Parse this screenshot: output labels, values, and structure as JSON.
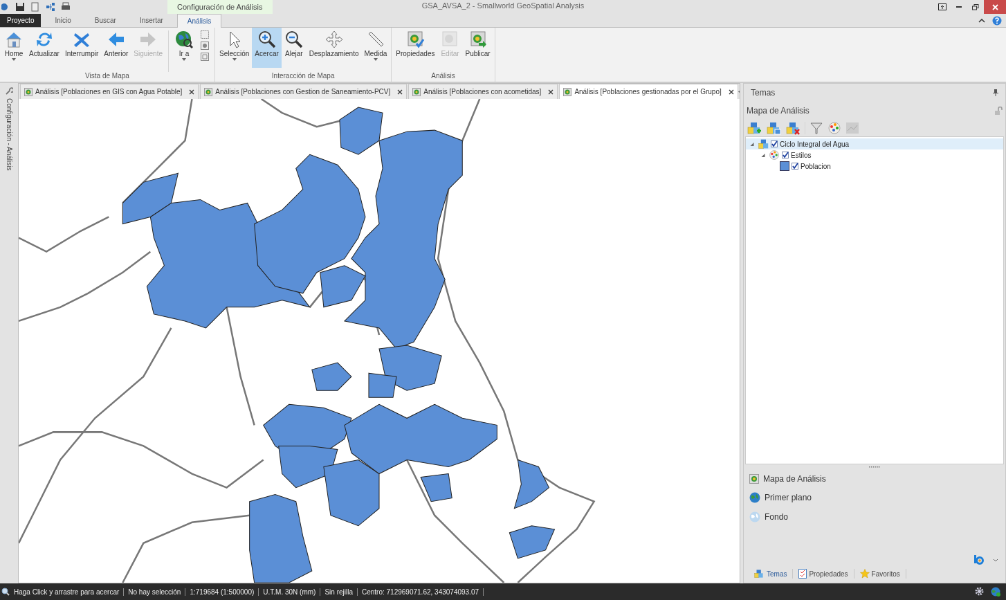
{
  "title_bar": {
    "context_tab": "Configuración de Análisis",
    "title": "GSA_AVSA_2 - Smallworld GeoSpatial Analysis"
  },
  "ribbon_tabs": [
    {
      "label": "Proyecto",
      "kind": "file",
      "selected": false
    },
    {
      "label": "Inicio",
      "kind": "tab",
      "selected": false
    },
    {
      "label": "Buscar",
      "kind": "tab",
      "selected": false
    },
    {
      "label": "Insertar",
      "kind": "tab",
      "selected": false
    },
    {
      "label": "Análisis",
      "kind": "tab",
      "selected": true
    }
  ],
  "ribbon_groups": [
    {
      "label": "Vista de Mapa",
      "buttons": [
        {
          "label": "Home",
          "dropdown": true,
          "disabled": false,
          "selected": false
        },
        {
          "label": "Actualizar",
          "dropdown": false,
          "disabled": false,
          "selected": false
        },
        {
          "label": "Interrumpir",
          "dropdown": false,
          "disabled": false,
          "selected": false
        },
        {
          "label": "Anterior",
          "dropdown": false,
          "disabled": false,
          "selected": false
        },
        {
          "label": "Siguiente",
          "dropdown": false,
          "disabled": true,
          "selected": false
        },
        {
          "label": "Ir a",
          "dropdown": true,
          "disabled": false,
          "selected": false
        }
      ]
    },
    {
      "label": "Interacción de Mapa",
      "buttons": [
        {
          "label": "Selección",
          "dropdown": true,
          "disabled": false,
          "selected": false
        },
        {
          "label": "Acercar",
          "dropdown": false,
          "disabled": false,
          "selected": true
        },
        {
          "label": "Alejar",
          "dropdown": false,
          "disabled": false,
          "selected": false
        },
        {
          "label": "Desplazamiento",
          "dropdown": false,
          "disabled": false,
          "selected": false
        },
        {
          "label": "Medida",
          "dropdown": true,
          "disabled": false,
          "selected": false
        }
      ]
    },
    {
      "label": "Análisis",
      "buttons": [
        {
          "label": "Propiedades",
          "dropdown": false,
          "disabled": false,
          "selected": false
        },
        {
          "label": "Editar",
          "dropdown": false,
          "disabled": true,
          "selected": false
        },
        {
          "label": "Publicar",
          "dropdown": false,
          "disabled": false,
          "selected": false
        }
      ]
    }
  ],
  "side_strip": {
    "label": "Configuración - Análisis"
  },
  "document_tabs": [
    {
      "label": "Análisis [Poblaciones en GIS con Agua Potable]",
      "selected": false
    },
    {
      "label": "Análisis [Poblaciones con Gestion de Saneamiento-PCV]",
      "selected": false
    },
    {
      "label": "Análisis [Poblaciones con acometidas]",
      "selected": false
    },
    {
      "label": "Análisis [Poblaciones gestionadas por el Grupo]",
      "selected": true
    }
  ],
  "panel": {
    "title": "Temas",
    "subtitle": "Mapa de Análisis",
    "tree": [
      {
        "label": "Ciclo Integral del Agua",
        "checked": true,
        "expanded": true,
        "selected": true,
        "children": [
          {
            "label": "Estilos",
            "checked": true,
            "expanded": true,
            "selected": false,
            "children": [
              {
                "label": "Poblacion",
                "checked": true,
                "selected": false,
                "color": "#5b8fd6"
              }
            ]
          }
        ]
      }
    ],
    "maps": [
      {
        "label": "Mapa de Análisis"
      },
      {
        "label": "Primer plano"
      },
      {
        "label": "Fondo"
      }
    ],
    "bottom_tabs": [
      {
        "label": "Temas",
        "selected": true
      },
      {
        "label": "Propiedades",
        "selected": false
      },
      {
        "label": "Favoritos",
        "selected": false
      }
    ]
  },
  "status_bar": [
    "Haga Click y arrastre para acercar",
    "No hay selección",
    "1:719684 (1:500000)",
    "U.T.M. 30N (mm)",
    "Sin rejilla",
    "Centro: 712969071.62, 343074093.07"
  ]
}
